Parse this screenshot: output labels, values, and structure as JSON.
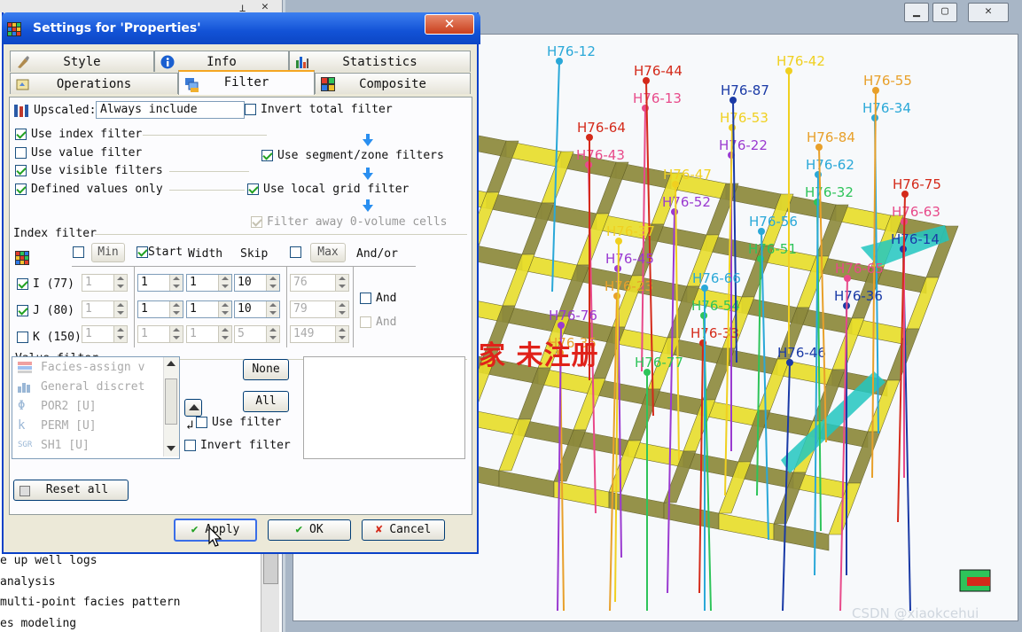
{
  "dialog": {
    "title": "Settings for 'Properties'",
    "close": "✕",
    "tabs": {
      "style": "Style",
      "info": "Info",
      "statistics": "Statistics",
      "operations": "Operations",
      "filter": "Filter",
      "composite": "Composite"
    },
    "upscaled_label": "Upscaled:",
    "upscaled_value": "Always include",
    "invert_total_filter": "Invert total filter",
    "use_index_filter": "Use index filter",
    "use_value_filter": "Use value filter",
    "use_visible_filters": "Use visible filters",
    "defined_values_only": "Defined values only",
    "use_segment_zone_filters": "Use segment/zone filters",
    "use_local_grid_filter": "Use local grid filter",
    "filter_away_zero_volume": "Filter away 0-volume cells",
    "index_filter_title": "Index filter",
    "col_min": "Min",
    "col_start": "Start",
    "col_width": "Width",
    "col_skip": "Skip",
    "col_max": "Max",
    "col_and_or": "And/or",
    "rows": [
      {
        "label": "I",
        "count": "(77)",
        "min": "1",
        "start": "1",
        "width": "1",
        "skip": "10",
        "max": "76"
      },
      {
        "label": "J",
        "count": "(80)",
        "min": "1",
        "start": "1",
        "width": "1",
        "skip": "10",
        "max": "79"
      },
      {
        "label": "K",
        "count": "(150)",
        "min": "1",
        "start": "1",
        "width": "1",
        "skip": "5",
        "max": "149"
      }
    ],
    "and_1": "And",
    "and_2": "And",
    "value_filter_title": "Value filter",
    "value_items": [
      "Facies-assign v",
      "General discret",
      "POR2 [U]",
      "PERM [U]",
      "SH1 [U]"
    ],
    "value_icon_text": "SGR",
    "none_btn": "None",
    "all_btn": "All",
    "use_filter": "Use filter",
    "invert_filter": "Invert filter",
    "reset_all": "Reset all",
    "apply": "Apply",
    "ok": "OK",
    "cancel": "Cancel"
  },
  "left_tree": [
    "e up well logs",
    " analysis",
    " multi-point facies pattern",
    "es modeling"
  ],
  "viewer": {
    "wells": [
      "H76-12",
      "H76-13",
      "H76-22",
      "H76-32",
      "H76-14",
      "H76-23",
      "H76-33",
      "H76-42",
      "H76-34",
      "H76-43",
      "H76-52",
      "H76-51",
      "H76-36",
      "H76-35",
      "H76-44",
      "H76-53",
      "H76-62",
      "H76-63",
      "H76-45",
      "H76-54",
      "H76-46",
      "H76-55",
      "H76-64",
      "H76-47",
      "H76-56",
      "H76-65",
      "H76-76",
      "H76-77",
      "H76-87",
      "H76-84",
      "H76-75",
      "H76-37",
      "H76-66"
    ],
    "watermark": "屏幕录像专家   未注册",
    "credit": "CSDN @xiaokcehui"
  },
  "colors": {
    "title_bar": "#1252d6",
    "dialog_bg": "#ece9d8",
    "grid_olive": "#8d8a3c",
    "grid_yellow": "#e8de2c",
    "cyan": "#22c7c0",
    "watermark_red": "#e0221a"
  }
}
